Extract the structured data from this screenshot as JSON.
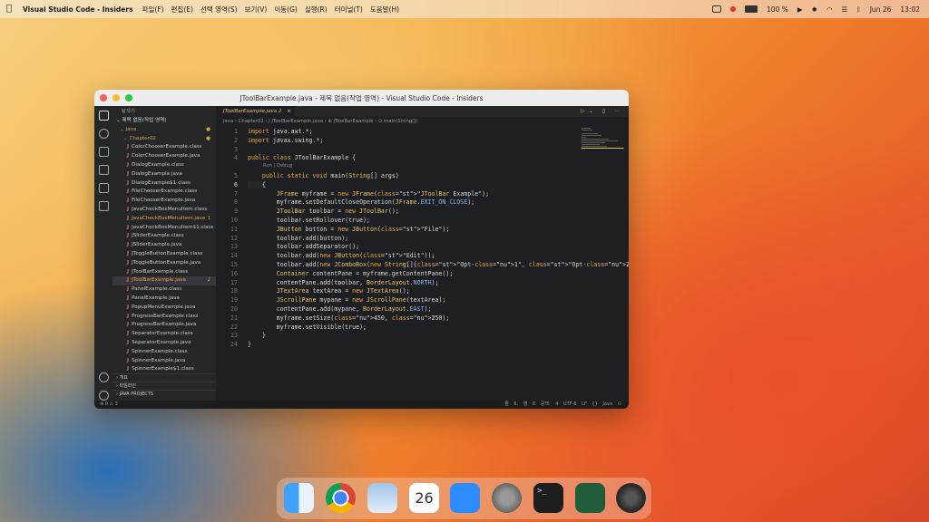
{
  "menubar": {
    "app_name": "Visual Studio Code - Insiders",
    "menus": [
      "파일(F)",
      "편집(E)",
      "선택 영역(S)",
      "보기(V)",
      "이동(G)",
      "실행(R)",
      "터미널(T)",
      "도움말(H)"
    ],
    "battery": "100 %",
    "date": "Jun 26",
    "time": "13:02"
  },
  "window": {
    "title": "JToolBarExample.java - 제목 없음(작업 영역) - Visual Studio Code - Insiders",
    "traffic_colors": [
      "#ff5f57",
      "#febc2e",
      "#28c840"
    ]
  },
  "sidebar": {
    "header": "탐색기",
    "workspace": "제목 없음(작업 영역)",
    "root": "Java",
    "folder": "Chapter02",
    "files": [
      {
        "name": "ColorChooserExample.class",
        "mod": ""
      },
      {
        "name": "ColorChooserExample.java",
        "mod": ""
      },
      {
        "name": "DialogExample.class",
        "mod": ""
      },
      {
        "name": "DialogExample.java",
        "mod": ""
      },
      {
        "name": "DialogExample$1.class",
        "mod": ""
      },
      {
        "name": "FileChooserExample.class",
        "mod": ""
      },
      {
        "name": "FileChooserExample.java",
        "mod": ""
      },
      {
        "name": "JavaCheckBoxMenuItem.class",
        "mod": ""
      },
      {
        "name": "JavaCheckBoxMenuItem.java",
        "mod": "1"
      },
      {
        "name": "JavaCheckBoxMenuItem$1.class",
        "mod": ""
      },
      {
        "name": "JSliderExample.class",
        "mod": ""
      },
      {
        "name": "JSliderExample.java",
        "mod": ""
      },
      {
        "name": "JToggleButtonExample.class",
        "mod": ""
      },
      {
        "name": "JToggleButtonExample.java",
        "mod": ""
      },
      {
        "name": "JToolBarExample.class",
        "mod": ""
      },
      {
        "name": "JToolBarExample.java",
        "mod": "2"
      },
      {
        "name": "PanelExample.class",
        "mod": ""
      },
      {
        "name": "PanelExample.java",
        "mod": ""
      },
      {
        "name": "PopupMenuExample.java",
        "mod": ""
      },
      {
        "name": "ProgressBarExample.class",
        "mod": ""
      },
      {
        "name": "ProgressBarExample.java",
        "mod": ""
      },
      {
        "name": "SeparatorExample.class",
        "mod": ""
      },
      {
        "name": "SeparatorExample.java",
        "mod": ""
      },
      {
        "name": "SpinnerExample.class",
        "mod": ""
      },
      {
        "name": "SpinnerExample.java",
        "mod": ""
      },
      {
        "name": "SpinnerExample$1.class",
        "mod": ""
      }
    ],
    "sections": [
      "개요",
      "타임라인",
      "JAVA PROJECTS"
    ]
  },
  "editor": {
    "tab_label": "JToolBarExample.java 2",
    "breadcrumbs": "Java  ›  Chapter02  ›  J  JToolBarExample.java  ›  ⊕ JToolBarExample  ›  ⊙ main(String[])",
    "code_lens": "Run | Debug",
    "lines": [
      {
        "n": "1",
        "t": "import java.awt.*;"
      },
      {
        "n": "2",
        "t": "import javax.swing.*;"
      },
      {
        "n": "3",
        "t": ""
      },
      {
        "n": "4",
        "t": "public class JToolBarExample {"
      },
      {
        "n": "5",
        "t": "    public static void main(String[] args)"
      },
      {
        "n": "6",
        "t": "    {"
      },
      {
        "n": "7",
        "t": "        JFrame myframe = new JFrame(\"JToolBar Example\");"
      },
      {
        "n": "8",
        "t": "        myframe.setDefaultCloseOperation(JFrame.EXIT_ON_CLOSE);"
      },
      {
        "n": "9",
        "t": "        JToolBar toolbar = new JToolBar();"
      },
      {
        "n": "10",
        "t": "        toolbar.setRollover(true);"
      },
      {
        "n": "11",
        "t": "        JButton button = new JButton(\"File\");"
      },
      {
        "n": "12",
        "t": "        toolbar.add(button);"
      },
      {
        "n": "13",
        "t": "        toolbar.addSeparator();"
      },
      {
        "n": "14",
        "t": "        toolbar.add(new JButton(\"Edit\"));"
      },
      {
        "n": "15",
        "t": "        toolbar.add(new JComboBox(new String[]{\"Opt-1\", \"Opt-2\", \"Opt-3\", \"Opt-4\"}));"
      },
      {
        "n": "16",
        "t": "        Container contentPane = myframe.getContentPane();"
      },
      {
        "n": "17",
        "t": "        contentPane.add(toolbar, BorderLayout.NORTH);"
      },
      {
        "n": "18",
        "t": "        JTextArea textArea = new JTextArea();"
      },
      {
        "n": "19",
        "t": "        JScrollPane mypane = new JScrollPane(textArea);"
      },
      {
        "n": "20",
        "t": "        contentPane.add(mypane, BorderLayout.EAST);"
      },
      {
        "n": "21",
        "t": "        myframe.setSize(450, 250);"
      },
      {
        "n": "22",
        "t": "        myframe.setVisible(true);"
      },
      {
        "n": "23",
        "t": "    }"
      },
      {
        "n": "24",
        "t": "}"
      }
    ]
  },
  "statusbar": {
    "left": "⊗ 0  ⚠ 3",
    "right": "줄 6, 열 6   공백: 4   UTF-8   LF   {} Java   ⚇"
  },
  "dock": {
    "apps": [
      "finder-icon",
      "chrome-icon",
      "preview-icon",
      "calendar-icon",
      "zoom-icon",
      "system-preferences-icon",
      "terminal-icon",
      "vscode-insiders-icon",
      "settings-icon"
    ],
    "calendar_day": "26"
  }
}
